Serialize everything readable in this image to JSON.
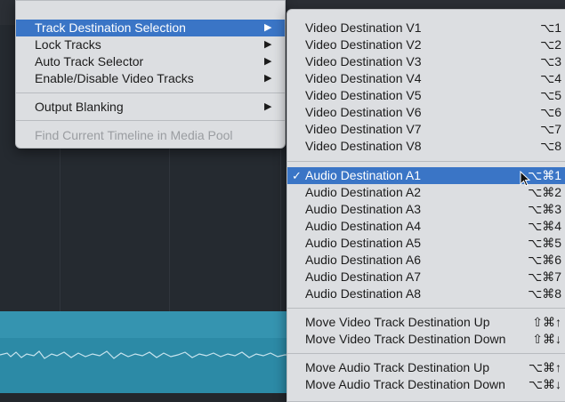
{
  "left_menu": {
    "items": [
      {
        "label": "Track Destination Selection",
        "has_submenu": true,
        "highlighted": true
      },
      {
        "label": "Lock Tracks",
        "has_submenu": true
      },
      {
        "label": "Auto Track Selector",
        "has_submenu": true
      },
      {
        "label": "Enable/Disable Video Tracks",
        "has_submenu": true
      },
      {
        "label": "Output Blanking",
        "has_submenu": true
      },
      {
        "label": "Find Current Timeline in Media Pool",
        "disabled": true
      }
    ],
    "arrow": "▶"
  },
  "sub_menu": {
    "video": [
      {
        "label": "Video Destination V1",
        "shortcut": "⌥1"
      },
      {
        "label": "Video Destination V2",
        "shortcut": "⌥2"
      },
      {
        "label": "Video Destination V3",
        "shortcut": "⌥3"
      },
      {
        "label": "Video Destination V4",
        "shortcut": "⌥4"
      },
      {
        "label": "Video Destination V5",
        "shortcut": "⌥5"
      },
      {
        "label": "Video Destination V6",
        "shortcut": "⌥6"
      },
      {
        "label": "Video Destination V7",
        "shortcut": "⌥7"
      },
      {
        "label": "Video Destination V8",
        "shortcut": "⌥8"
      }
    ],
    "audio": [
      {
        "label": "Audio Destination A1",
        "shortcut": "⌥⌘1",
        "checked": true,
        "highlighted": true
      },
      {
        "label": "Audio Destination A2",
        "shortcut": "⌥⌘2"
      },
      {
        "label": "Audio Destination A3",
        "shortcut": "⌥⌘3"
      },
      {
        "label": "Audio Destination A4",
        "shortcut": "⌥⌘4"
      },
      {
        "label": "Audio Destination A5",
        "shortcut": "⌥⌘5"
      },
      {
        "label": "Audio Destination A6",
        "shortcut": "⌥⌘6"
      },
      {
        "label": "Audio Destination A7",
        "shortcut": "⌥⌘7"
      },
      {
        "label": "Audio Destination A8",
        "shortcut": "⌥⌘8"
      }
    ],
    "move_video": [
      {
        "label": "Move Video Track Destination Up",
        "shortcut": "⇧⌘↑"
      },
      {
        "label": "Move Video Track Destination Down",
        "shortcut": "⇧⌘↓"
      }
    ],
    "move_audio": [
      {
        "label": "Move Audio Track Destination Up",
        "shortcut": "⌥⌘↑"
      },
      {
        "label": "Move Audio Track Destination Down",
        "shortcut": "⌥⌘↓"
      }
    ],
    "checkmark": "✓"
  },
  "colors": {
    "highlight": "#3a75c6",
    "menu_bg": "#dcdee1",
    "timeline_bg": "#252a30",
    "audio_track": "#2c8aa6"
  }
}
